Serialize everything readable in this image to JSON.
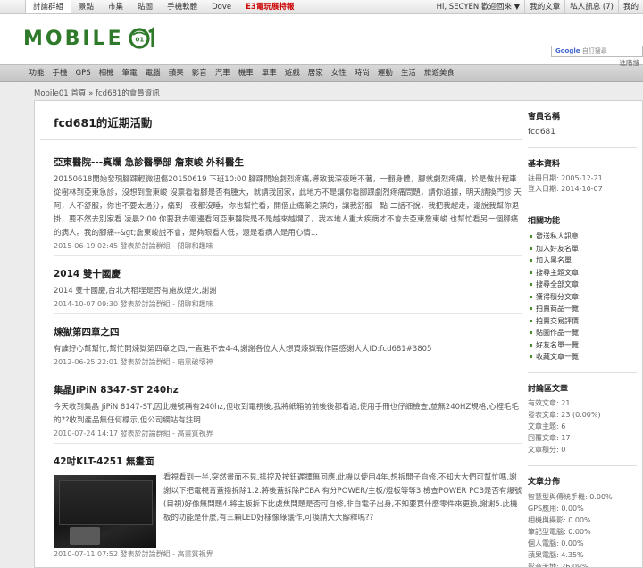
{
  "topbar": {
    "tabs": [
      {
        "label": "討論群組",
        "active": true
      },
      {
        "label": "景點"
      },
      {
        "label": "市集"
      },
      {
        "label": "貼圖"
      },
      {
        "label": "手機軟體"
      },
      {
        "label": "Dove"
      },
      {
        "label": "E3電玩展特報",
        "highlight": true
      }
    ],
    "welcome": "Hi, SECYEN 歡迎回來 ▼",
    "my_posts": "我的文章",
    "messages": "私人訊息 (7)",
    "friends": "我的"
  },
  "header": {
    "logo_text": "MOBILE",
    "logo_number": "01",
    "search_brand": "Google",
    "search_placeholder": "自訂搜尋",
    "advanced_search": "進階搜"
  },
  "nav": [
    "功能",
    "手機",
    "GPS",
    "相機",
    "筆電",
    "電腦",
    "蘋果",
    "影音",
    "汽車",
    "機車",
    "單車",
    "遊戲",
    "居家",
    "女性",
    "時尚",
    "運動",
    "生活",
    "旅遊美食"
  ],
  "breadcrumb": "Mobile01 首頁 » fcd681的會員資訊",
  "main": {
    "title": "fcd681的近期活動",
    "posts": [
      {
        "title": "亞東醫院---真爛 急診醫學部 詹東峻 外科醫生",
        "body": "20150618開始發現腳踝輕微扭傷20150619 下班10:00 腳踝開始劇烈疼痛,導致我深夜睡不著，一翻身體，腳就劇烈疼痛，於是做計程車從樹林到亞東急診，沒想到詹東峻 沒票看看腳是否有腫大，就請我回家，此地方不是讓你看腳踝劇烈疼痛問題，請你過據，明天請換門診 天阿，人不舒服，你也不要太過分，痛到一夜都沒睡，你也幫忙看，開個止痛藥之類的，讓我舒服一點 二話不說，我把我趕走，還說我幫你退掛，要不然去別家看 凌晨2:00 你要我去哪邊看阿亞東醫院是不是越來越爛了，我本地人重大疾病才不會去亞東詹東峻 也幫忙看另一個腳痛的病人。我的腳痛--&gt;詹東峻說不會，是夠眼看人低，還是看病人是用心情...",
        "meta": "2015-06-19 02:45 發表於討論群組 - 閒聊和趣味"
      },
      {
        "title": "2014 雙十國慶",
        "body": "2014 雙十國慶,台北大稻埕是否有施放煙火,謝謝",
        "meta": "2014-10-07 09:30 發表於討論群組 - 閒聊和趣味"
      },
      {
        "title": "煉獄第四章之四",
        "body": "有誰好心幫幫忙,幫忙開煉獄第四章之四,一直進不去4-4,謝謝各位大大想買煉獄戰作區感謝大大ID:fcd681#3805",
        "meta": "2012-06-25 22:01 發表於討論群組 - 暗黑破壞神"
      },
      {
        "title": "集晶JiPiN 8347-ST 240hz",
        "body": "今天收到集晶 JiPiN 8147-ST,因此機號稱有240hz,但收到電視後,我將紙箱前前後後都看過,使用手冊也仔細檢查,並無240HZ規格,心裡毛毛的??收到產品無任何標示,但公司網站有註明",
        "meta": "2010-07-24 14:17 發表於討論群組 - 高畫質視界"
      },
      {
        "title": "42吋KLT-4251 無畫面",
        "body": "看視看到一半,突然畫面不見,搖控及按鈕遲擇無回應,此機以使用4年,想拆開子自修,不知大大們可幫忙嗎,謝謝以下把電視背蓋撥拆除1.2.將後蓋拆除PCBA 有分POWER/主板/燈板等等3.檢查POWER PCB是否有爆號(目視)好像無問題4.將主板拆下比處焦問題是否可自修,非自電子出身,不知要買什麼零件來更換,謝謝5.此機板的功能是什麼,有三顆LED好樣像綠議作,可換請大大解釋嗎??",
        "meta": "2010-07-11 07:52 發表於討論群組 - 高畫質視界"
      }
    ]
  },
  "sidebar": {
    "member_name_head": "會員名稱",
    "member_name": "fcd681",
    "basic_head": "基本資料",
    "registered": "註冊日期: 2005-12-21",
    "last_login": "登入日期: 2014-10-07",
    "related_head": "相關功能",
    "related": [
      "發送私人訊息",
      "加入好友名單",
      "加入黑名單",
      "搜尋主題文章",
      "搜尋全部文章",
      "獲得積分文章",
      "拍賣商品一覽",
      "拍賣交易評價",
      "貼圖作品一覽",
      "好友名單一覽",
      "收藏文章一覽"
    ],
    "forum_head": "討論區文章",
    "forum_stats": [
      "有效文章: 21",
      "發表文章: 23 (0.00%)",
      "文章主題: 6",
      "回覆文章: 17",
      "文章積分: 0"
    ],
    "dist_head": "文章分佈",
    "distribution": [
      "智慧型與傳統手機: 0.00%",
      "GPS應用: 0.00%",
      "相機與攝影: 0.00%",
      "筆記型電腦: 0.00%",
      "個人電腦: 0.00%",
      "蘋果電腦: 4.35%",
      "影音天地: 26.09%"
    ]
  }
}
